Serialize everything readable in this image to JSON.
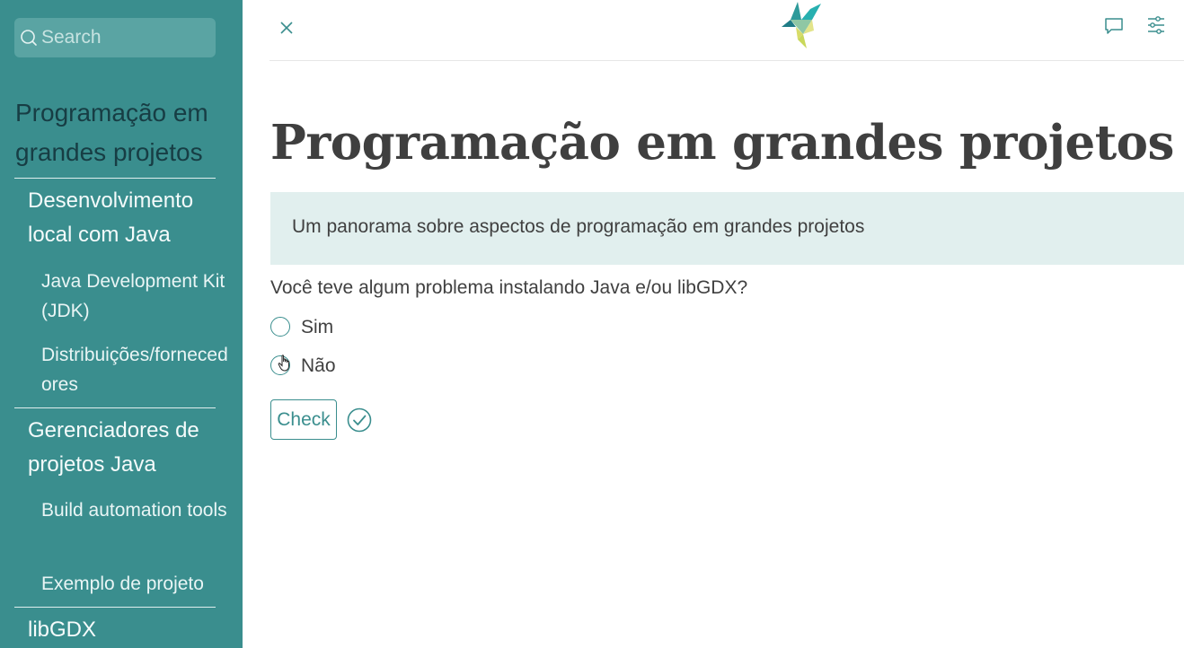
{
  "sidebar": {
    "search_placeholder": "Search",
    "title": "Programação em grandes projetos",
    "sections": [
      {
        "label": "Desenvolvimento local com Java",
        "items": [
          "Java Development Kit (JDK)",
          "Distribuições/fornecedores"
        ]
      },
      {
        "label": "Gerenciadores de projetos Java",
        "items": [
          "Build automation tools",
          "Exemplo de projeto"
        ]
      },
      {
        "label": "libGDX",
        "items": []
      }
    ]
  },
  "header": {
    "close_icon": "close-icon",
    "logo": "bird-logo",
    "comment_icon": "comment-icon",
    "settings_icon": "sliders-icon"
  },
  "main": {
    "title": "Programação em grandes projetos",
    "banner": "Um panorama sobre aspectos de programação em grandes projetos",
    "question": "Você teve algum problema instalando Java e/ou libGDX?",
    "options": [
      {
        "label": "Sim",
        "selected": false
      },
      {
        "label": "Não",
        "selected": false
      }
    ],
    "check_label": "Check"
  },
  "colors": {
    "sidebar_bg": "#3a8e8e",
    "accent": "#3a8e8e",
    "banner_bg": "#e1efee"
  }
}
